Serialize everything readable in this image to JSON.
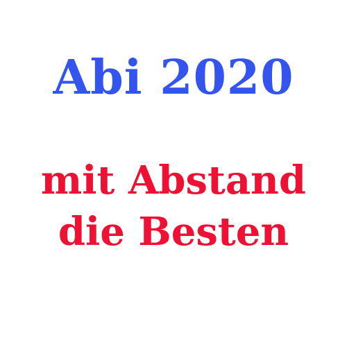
{
  "headline": {
    "text": "Abi 2020",
    "color": "#3355ee"
  },
  "motto": {
    "line1": "mit Abstand",
    "line2": "die Besten",
    "color": "#ee1133"
  },
  "background": "#ffffff"
}
